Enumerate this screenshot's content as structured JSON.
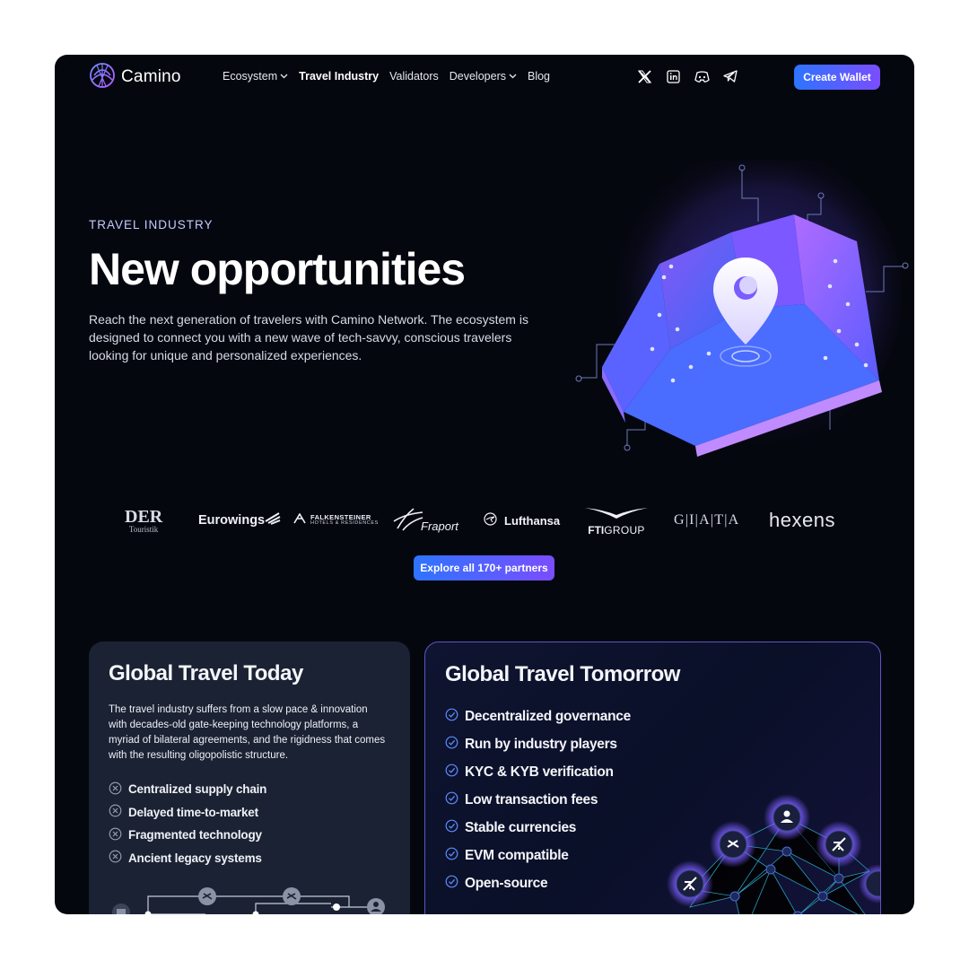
{
  "header": {
    "brand": "Camino",
    "nav": [
      {
        "label": "Ecosystem",
        "dropdown": true
      },
      {
        "label": "Travel Industry",
        "active": true
      },
      {
        "label": "Validators"
      },
      {
        "label": "Developers",
        "dropdown": true
      },
      {
        "label": "Blog"
      }
    ],
    "social_icons": [
      "x-icon",
      "linkedin-icon",
      "discord-icon",
      "telegram-icon"
    ],
    "cta_label": "Create Wallet"
  },
  "hero": {
    "eyebrow": "TRAVEL INDUSTRY",
    "title": "New opportunities",
    "description": "Reach the next generation of travelers with Camino Network. The ecosystem is designed to connect you with a new wave of tech-savvy, conscious travelers looking for unique and personalized experiences."
  },
  "partners": {
    "logos": {
      "der_main": "DER",
      "der_sub": "Touristik",
      "eurowings": "Eurowings",
      "falkensteiner_main": "FALKENSTEINER",
      "falkensteiner_sub": "HOTELS & RESIDENCES",
      "fraport": "Fraport",
      "lufthansa": "Lufthansa",
      "fti_bold": "FTI",
      "fti_light": "GROUP",
      "giata": "G|I|A|T|A",
      "hexens": "hexens"
    },
    "cta_label": "Explore all 170+ partners"
  },
  "today_card": {
    "title": "Global Travel Today",
    "description": "The travel industry suffers from a slow pace & innovation with decades-old gate-keeping technology platforms, a myriad of bilateral agreements, and the rigidness that comes with the resulting oligopolistic structure.",
    "items": [
      "Centralized supply chain",
      "Delayed time-to-market",
      "Fragmented technology",
      "Ancient legacy systems"
    ]
  },
  "tomorrow_card": {
    "title": "Global Travel Tomorrow",
    "items": [
      "Decentralized governance",
      "Run by industry players",
      "KYC & KYB verification",
      "Low transaction fees",
      "Stable currencies",
      "EVM compatible",
      "Open-source"
    ]
  },
  "colors": {
    "background": "#05070f",
    "accent_blue": "#2e74ff",
    "accent_purple": "#7a4dff",
    "eyebrow": "#c3ccff",
    "check": "#5b8cff"
  }
}
